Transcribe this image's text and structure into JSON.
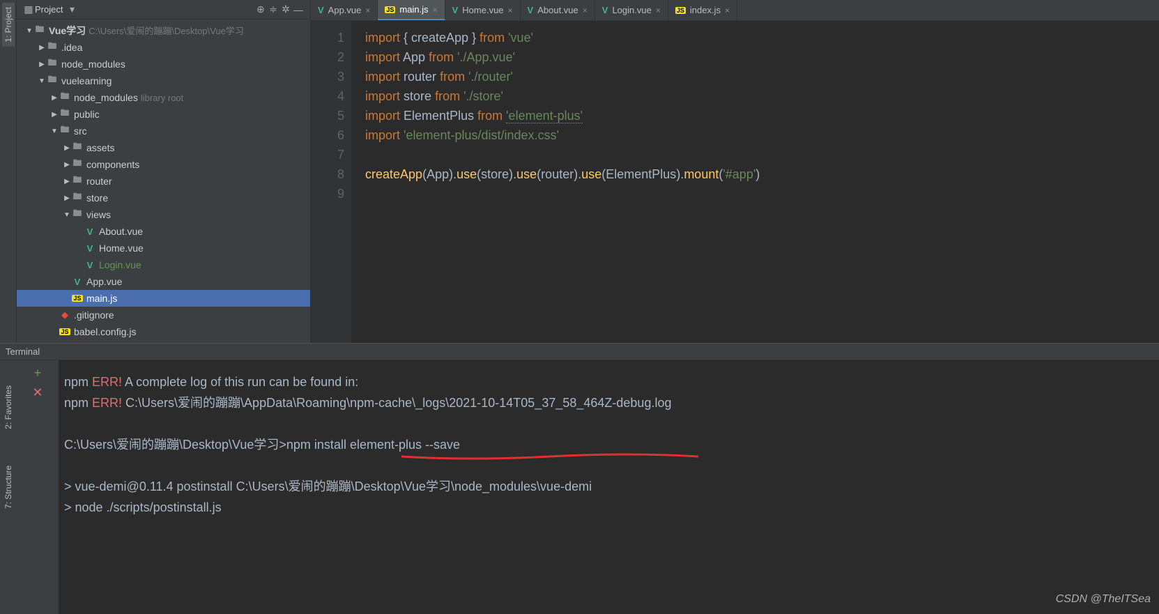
{
  "sideTabs": {
    "project": "1: Project",
    "favorites": "2: Favorites",
    "structure": "7: Structure"
  },
  "projectPanel": {
    "title": "Project",
    "tree": [
      {
        "depth": 0,
        "arrow": "▼",
        "icon": "folder",
        "label": "Vue学习",
        "suffix": "C:\\Users\\爱闹的蹦蹦\\Desktop\\Vue学习",
        "bold": true
      },
      {
        "depth": 1,
        "arrow": "▶",
        "icon": "folder",
        "label": ".idea"
      },
      {
        "depth": 1,
        "arrow": "▶",
        "icon": "folder",
        "label": "node_modules"
      },
      {
        "depth": 1,
        "arrow": "▼",
        "icon": "folder",
        "label": "vuelearning"
      },
      {
        "depth": 2,
        "arrow": "▶",
        "icon": "folder",
        "label": "node_modules",
        "suffix": "library root"
      },
      {
        "depth": 2,
        "arrow": "▶",
        "icon": "folder",
        "label": "public"
      },
      {
        "depth": 2,
        "arrow": "▼",
        "icon": "folder",
        "label": "src"
      },
      {
        "depth": 3,
        "arrow": "▶",
        "icon": "folder",
        "label": "assets"
      },
      {
        "depth": 3,
        "arrow": "▶",
        "icon": "folder",
        "label": "components"
      },
      {
        "depth": 3,
        "arrow": "▶",
        "icon": "folder",
        "label": "router"
      },
      {
        "depth": 3,
        "arrow": "▶",
        "icon": "folder",
        "label": "store"
      },
      {
        "depth": 3,
        "arrow": "▼",
        "icon": "folder",
        "label": "views"
      },
      {
        "depth": 4,
        "arrow": "",
        "icon": "vue",
        "label": "About.vue"
      },
      {
        "depth": 4,
        "arrow": "",
        "icon": "vue",
        "label": "Home.vue"
      },
      {
        "depth": 4,
        "arrow": "",
        "icon": "vue",
        "label": "Login.vue",
        "green": true
      },
      {
        "depth": 3,
        "arrow": "",
        "icon": "vue",
        "label": "App.vue"
      },
      {
        "depth": 3,
        "arrow": "",
        "icon": "js",
        "label": "main.js",
        "selected": true
      },
      {
        "depth": 2,
        "arrow": "",
        "icon": "git",
        "label": ".gitignore"
      },
      {
        "depth": 2,
        "arrow": "",
        "icon": "js",
        "label": "babel.config.js"
      }
    ]
  },
  "editor": {
    "tabs": [
      {
        "icon": "vue",
        "label": "App.vue"
      },
      {
        "icon": "js",
        "label": "main.js",
        "active": true
      },
      {
        "icon": "vue",
        "label": "Home.vue"
      },
      {
        "icon": "vue",
        "label": "About.vue"
      },
      {
        "icon": "vue",
        "label": "Login.vue"
      },
      {
        "icon": "js",
        "label": "index.js"
      }
    ],
    "lineCount": 9,
    "code": [
      [
        [
          "kw",
          "import"
        ],
        [
          "pu",
          " { "
        ],
        [
          "id",
          "createApp"
        ],
        [
          "pu",
          " } "
        ],
        [
          "kw",
          "from"
        ],
        [
          "pu",
          " "
        ],
        [
          "str",
          "'vue'"
        ]
      ],
      [
        [
          "kw",
          "import"
        ],
        [
          "pu",
          " "
        ],
        [
          "id",
          "App"
        ],
        [
          "pu",
          " "
        ],
        [
          "kw",
          "from"
        ],
        [
          "pu",
          " "
        ],
        [
          "str",
          "'./App.vue'"
        ]
      ],
      [
        [
          "kw",
          "import"
        ],
        [
          "pu",
          " "
        ],
        [
          "id",
          "router"
        ],
        [
          "pu",
          " "
        ],
        [
          "kw",
          "from"
        ],
        [
          "pu",
          " "
        ],
        [
          "str",
          "'./router'"
        ]
      ],
      [
        [
          "kw",
          "import"
        ],
        [
          "pu",
          " "
        ],
        [
          "id",
          "store"
        ],
        [
          "pu",
          " "
        ],
        [
          "kw",
          "from"
        ],
        [
          "pu",
          " "
        ],
        [
          "str",
          "'./store'"
        ]
      ],
      [
        [
          "kw",
          "import"
        ],
        [
          "pu",
          " "
        ],
        [
          "id",
          "ElementPlus"
        ],
        [
          "pu",
          " "
        ],
        [
          "kw",
          "from"
        ],
        [
          "pu",
          " "
        ],
        [
          "str und",
          "'element-plus'"
        ]
      ],
      [
        [
          "kw",
          "import"
        ],
        [
          "pu",
          " "
        ],
        [
          "str",
          "'element-plus/dist/index.css'"
        ]
      ],
      [],
      [
        [
          "fn",
          "createApp"
        ],
        [
          "pu",
          "("
        ],
        [
          "id",
          "App"
        ],
        [
          "pu",
          ")."
        ],
        [
          "fn",
          "use"
        ],
        [
          "pu",
          "("
        ],
        [
          "id",
          "store"
        ],
        [
          "pu",
          ")."
        ],
        [
          "fn",
          "use"
        ],
        [
          "pu",
          "("
        ],
        [
          "id",
          "router"
        ],
        [
          "pu",
          ")."
        ],
        [
          "fn",
          "use"
        ],
        [
          "pu",
          "("
        ],
        [
          "id",
          "ElementPlus"
        ],
        [
          "pu",
          ")."
        ],
        [
          "fn",
          "mount"
        ],
        [
          "pu",
          "("
        ],
        [
          "str",
          "'#app'"
        ],
        [
          "pu",
          ")"
        ]
      ],
      []
    ]
  },
  "terminal": {
    "title": "Terminal",
    "lines": [
      {
        "segs": [
          [
            "id",
            "npm "
          ],
          [
            "err",
            "ERR!"
          ],
          [
            "id",
            " A complete log of this run can be found in:"
          ]
        ]
      },
      {
        "segs": [
          [
            "id",
            "npm "
          ],
          [
            "err",
            "ERR!"
          ],
          [
            "id",
            "     C:\\Users\\爱闹的蹦蹦\\AppData\\Roaming\\npm-cache\\_logs\\2021-10-14T05_37_58_464Z-debug.log"
          ]
        ]
      },
      {
        "segs": []
      },
      {
        "segs": [
          [
            "id",
            "C:\\Users\\爱闹的蹦蹦\\Desktop\\Vue学习>npm install element-plus --save"
          ]
        ]
      },
      {
        "segs": []
      },
      {
        "segs": [
          [
            "id",
            "> vue-demi@0.11.4 postinstall C:\\Users\\爱闹的蹦蹦\\Desktop\\Vue学习\\node_modules\\vue-demi"
          ]
        ]
      },
      {
        "segs": [
          [
            "id",
            "> node ./scripts/postinstall.js"
          ]
        ]
      }
    ],
    "watermark": "CSDN @TheITSea"
  }
}
